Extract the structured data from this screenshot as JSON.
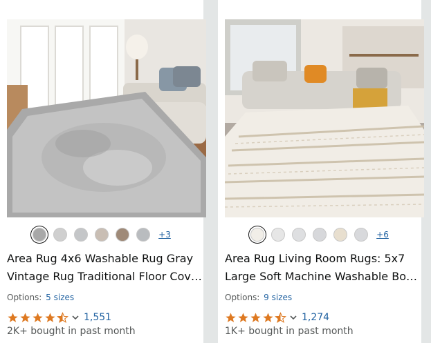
{
  "products": [
    {
      "image_alt": "Gray vintage area rug in living room",
      "swatch_colors": [
        "#a8a8a8",
        "#cfcfcf",
        "#c4c6c8",
        "#c9beb4",
        "#9f8a78",
        "#b9bcbf"
      ],
      "more_swatches": "+3",
      "title_line1": "Area Rug 4x6 Washable Rug Gray",
      "title_line2": "Vintage Rug Traditional Floor Cov…",
      "options_label": "Options:",
      "options_value": "5 sizes",
      "rating": 4.5,
      "rating_count": "1,551",
      "bought": "2K+ bought in past month"
    },
    {
      "image_alt": "Cream boho striped area rug in living room",
      "swatch_colors": [
        "#f1eee8",
        "#e6e6e6",
        "#dedfe1",
        "#d7d8db",
        "#e8dfcf",
        "#d8d9dc"
      ],
      "more_swatches": "+6",
      "title_line1": "Area Rug Living Room Rugs: 5x7",
      "title_line2": "Large Soft Machine Washable Bo…",
      "options_label": "Options:",
      "options_value": "9 sizes",
      "rating": 4.5,
      "rating_count": "1,274",
      "bought": "1K+ bought in past month"
    }
  ],
  "colors": {
    "star": "#de7921",
    "link": "#2162a1",
    "muted": "#565959"
  }
}
